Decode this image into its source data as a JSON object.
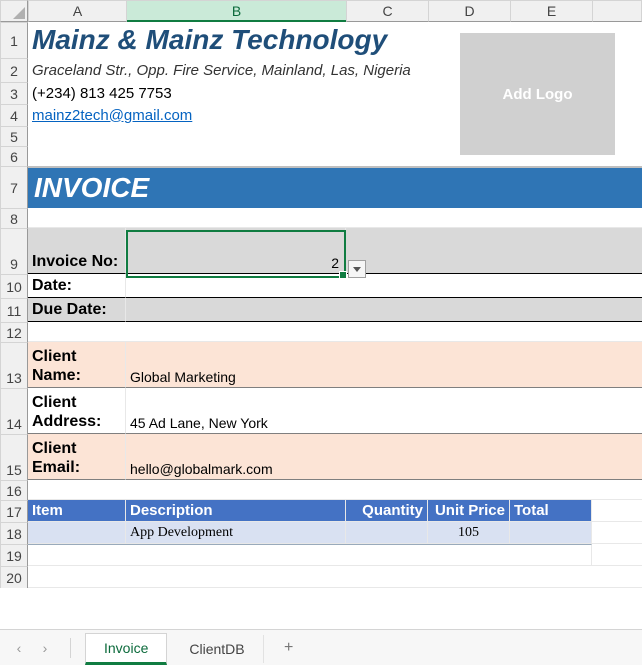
{
  "columns": [
    "A",
    "B",
    "C",
    "D",
    "E"
  ],
  "rows": [
    "1",
    "2",
    "3",
    "4",
    "5",
    "6",
    "7",
    "8",
    "9",
    "10",
    "11",
    "12",
    "13",
    "14",
    "15",
    "16",
    "17",
    "18",
    "19",
    "20"
  ],
  "active_cell": {
    "col": "B",
    "row": 9
  },
  "company": {
    "name": "Mainz & Mainz Technology",
    "address": "Graceland Str., Opp. Fire Service, Mainland, Las, Nigeria",
    "phone": "(+234) 813 425 7753",
    "email": "mainz2tech@gmail.com"
  },
  "logo_placeholder": "Add Logo",
  "banner": "INVOICE",
  "labels": {
    "invoice_no": "Invoice No:",
    "date": "Date:",
    "due_date": "Due Date:",
    "client_name": "Client Name:",
    "client_address": "Client Address:",
    "client_email": "Client Email:"
  },
  "values": {
    "invoice_no": "2",
    "date": "",
    "due_date": "",
    "client_name": "Global Marketing",
    "client_address": "45 Ad Lane, New York",
    "client_email": "hello@globalmark.com"
  },
  "table": {
    "headers": {
      "item": "Item",
      "description": "Description",
      "quantity": "Quantity",
      "unit_price": "Unit Price",
      "total": "Total"
    },
    "rows": [
      {
        "item": "",
        "description": "App Development",
        "quantity": "",
        "unit_price": "105",
        "total": ""
      }
    ]
  },
  "tabs": {
    "items": [
      "Invoice",
      "ClientDB"
    ],
    "active": "Invoice"
  }
}
